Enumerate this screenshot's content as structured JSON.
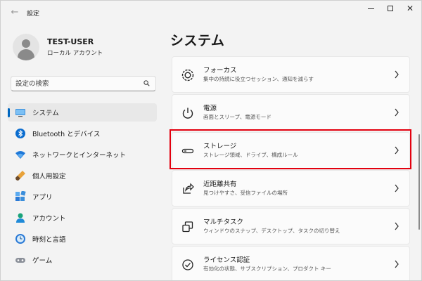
{
  "window": {
    "title": "設定"
  },
  "user": {
    "name": "TEST-USER",
    "account_type": "ローカル アカウント"
  },
  "search": {
    "placeholder": "設定の検索"
  },
  "nav": {
    "items": [
      {
        "label": "システム",
        "icon": "monitor-icon",
        "selected": true
      },
      {
        "label": "Bluetooth とデバイス",
        "icon": "bluetooth-icon"
      },
      {
        "label": "ネットワークとインターネット",
        "icon": "wifi-icon"
      },
      {
        "label": "個人用設定",
        "icon": "brush-icon"
      },
      {
        "label": "アプリ",
        "icon": "apps-icon"
      },
      {
        "label": "アカウント",
        "icon": "person-icon"
      },
      {
        "label": "時刻と言語",
        "icon": "clock-globe-icon"
      },
      {
        "label": "ゲーム",
        "icon": "gamepad-icon"
      }
    ]
  },
  "main": {
    "title": "システム",
    "cards": [
      {
        "title": "フォーカス",
        "subtitle": "集中の持続に役立つセッション、通知を減らす",
        "icon": "focus-icon"
      },
      {
        "title": "電源",
        "subtitle": "画面とスリープ、電源モード",
        "icon": "power-icon"
      },
      {
        "title": "ストレージ",
        "subtitle": "ストレージ領域、ドライブ、構成ルール",
        "icon": "storage-icon",
        "highlighted": true
      },
      {
        "title": "近距離共有",
        "subtitle": "見つけやすさ、受信ファイルの場所",
        "icon": "share-icon"
      },
      {
        "title": "マルチタスク",
        "subtitle": "ウィンドウのスナップ、デスクトップ、タスクの切り替え",
        "icon": "multitask-icon"
      },
      {
        "title": "ライセンス認証",
        "subtitle": "有効化の状態、サブスクリプション、プロダクト キー",
        "icon": "activation-icon"
      }
    ]
  },
  "colors": {
    "accent": "#0067c0",
    "highlight": "#e3000f",
    "background": "#f3f3f3"
  }
}
